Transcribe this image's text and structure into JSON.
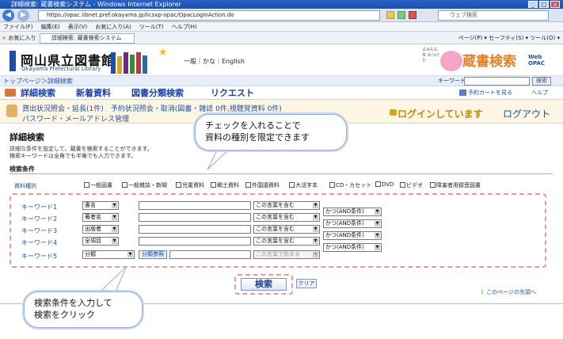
{
  "browser": {
    "title": "詳細検索: 蔵書検索システム - Windows Internet Explorer",
    "url": "https://opac.libnet.pref.okayama.jp/licsxp-opac/OpacLoginAction.do",
    "web_search_placeholder": "ウェブ検索",
    "menu": [
      "ファイル(F)",
      "編集(E)",
      "表示(V)",
      "お気に入り(A)",
      "ツール(T)",
      "ヘルプ(H)"
    ],
    "favorites_label": "お気に入り",
    "tab_title": "詳細検索: 蔵書検索システム",
    "toolbar_right": "ページ(P) ▾ セーフティ(S) ▾ ツール(O) ▾"
  },
  "header": {
    "library_name": "岡山県立図書館",
    "library_name_en": "Okayama Prefectural Library",
    "lang": "一般｜かな｜English",
    "catalog_name": "蔵書検索",
    "catalog_sub1": "Web",
    "catalog_sub2": "OPAC",
    "mascot_text": "よみもも 本 みつけた"
  },
  "breadcrumb": {
    "text": "トップページ＞詳細検索",
    "keyword_label": "キーワード",
    "search_button": "検索"
  },
  "nav": {
    "tabs": [
      "詳細検索",
      "新着資料",
      "図書分類検索",
      "リクエスト"
    ],
    "cart": "予約カートを見る",
    "help": "ヘルプ"
  },
  "status": {
    "line1": "貸出状況照会・延長(1件)　予約状況照会・取消(図書・雑誌 0件,視聴覚資料 0件)",
    "line2": "パスワード・メールアドレス管理",
    "login_message": "ログインしています",
    "logout": "ログアウト"
  },
  "page": {
    "title": "詳細検索",
    "desc1": "詳細な条件を設定して、蔵書を検索することができます。",
    "desc2": "検索キーワードは全角でも半角でも入力できます。",
    "conditions_title": "検索条件",
    "material_type_label": "資料種別",
    "material_types": [
      "一般図書",
      "一般雑誌・新聞",
      "児童資料",
      "郷土資料",
      "外国語資料",
      "大活字本",
      "CD・カセット",
      "DVD",
      "ビデオ",
      "障害者用録音図書"
    ]
  },
  "keywords": [
    {
      "label": "キーワード1",
      "field": "書名",
      "match": "この言葉を含む",
      "logic": "かつ(AND条件)"
    },
    {
      "label": "キーワード2",
      "field": "著者名",
      "match": "この言葉を含む",
      "logic": "かつ(AND条件)"
    },
    {
      "label": "キーワード3",
      "field": "出版者",
      "match": "この言葉を含む",
      "logic": "かつ(AND条件)"
    },
    {
      "label": "キーワード4",
      "field": "全項目",
      "match": "この言葉を含む",
      "logic": "かつ(AND条件)"
    },
    {
      "label": "キーワード5",
      "field": "分類",
      "match": "この言葉で始まる",
      "logic": ""
    }
  ],
  "buttons": {
    "classification_ref": "分類参照",
    "search": "検索",
    "clear": "クリア",
    "page_top": "このページの先頭へ"
  },
  "callouts": {
    "top_line1": "チェックを入れることで",
    "top_line2": "資料の種別を限定できます",
    "bottom_line1": "検索条件を入力して",
    "bottom_line2": "検索をクリック"
  }
}
